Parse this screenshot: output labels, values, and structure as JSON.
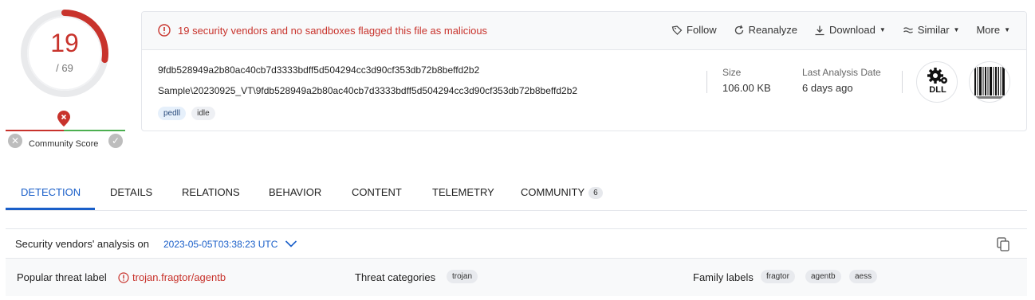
{
  "score": {
    "detections": "19",
    "total": "/ 69",
    "community_label": "Community Score",
    "ratio": 0.275
  },
  "alert": {
    "text": "19 security vendors and no sandboxes flagged this file as malicious",
    "color": "#c8332c"
  },
  "actions": {
    "follow": "Follow",
    "reanalyze": "Reanalyze",
    "download": "Download",
    "similar": "Similar",
    "more": "More"
  },
  "file": {
    "hash": "9fdb528949a2b80ac40cb7d3333bdff5d504294cc3d90cf353db72b8beffd2b2",
    "path": "Sample\\20230925_VT\\9fdb528949a2b80ac40cb7d3333bdff5d504294cc3d90cf353db72b8beffd2b2",
    "tags": [
      "pedll",
      "idle"
    ]
  },
  "meta": {
    "size_label": "Size",
    "size_value": "106.00 KB",
    "date_label": "Last Analysis Date",
    "date_value": "6 days ago"
  },
  "filetype": {
    "label": "DLL"
  },
  "tabs": [
    "DETECTION",
    "DETAILS",
    "RELATIONS",
    "BEHAVIOR",
    "CONTENT",
    "TELEMETRY",
    "COMMUNITY"
  ],
  "community_badge": "6",
  "analysis": {
    "title": "Security vendors' analysis on",
    "date": "2023-05-05T03:38:23 UTC"
  },
  "threat": {
    "popular_label": "Popular threat label",
    "popular_value": "trojan.fragtor/agentb",
    "categories_label": "Threat categories",
    "categories": [
      "trojan"
    ],
    "family_label": "Family labels",
    "families": [
      "fragtor",
      "agentb",
      "aess"
    ]
  },
  "colors": {
    "accent": "#1a5fc9",
    "danger": "#c8332c",
    "ok": "#4caf50"
  }
}
